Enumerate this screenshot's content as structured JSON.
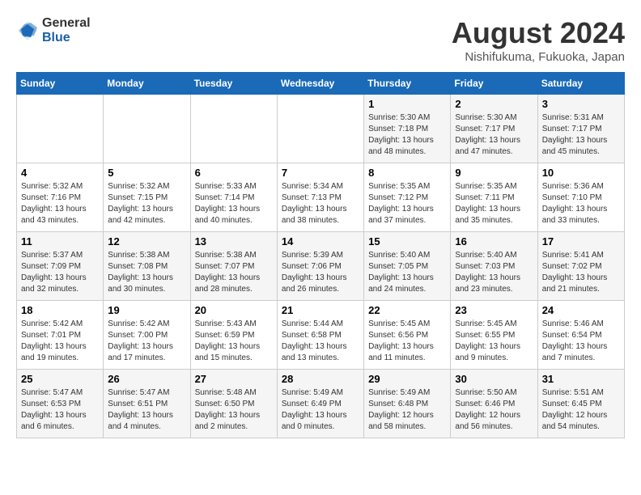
{
  "logo": {
    "general": "General",
    "blue": "Blue"
  },
  "title": "August 2024",
  "subtitle": "Nishifukuma, Fukuoka, Japan",
  "weekdays": [
    "Sunday",
    "Monday",
    "Tuesday",
    "Wednesday",
    "Thursday",
    "Friday",
    "Saturday"
  ],
  "weeks": [
    [
      {
        "day": "",
        "info": ""
      },
      {
        "day": "",
        "info": ""
      },
      {
        "day": "",
        "info": ""
      },
      {
        "day": "",
        "info": ""
      },
      {
        "day": "1",
        "sunrise": "5:30 AM",
        "sunset": "7:18 PM",
        "daylight": "13 hours and 48 minutes."
      },
      {
        "day": "2",
        "sunrise": "5:30 AM",
        "sunset": "7:17 PM",
        "daylight": "13 hours and 47 minutes."
      },
      {
        "day": "3",
        "sunrise": "5:31 AM",
        "sunset": "7:17 PM",
        "daylight": "13 hours and 45 minutes."
      }
    ],
    [
      {
        "day": "4",
        "sunrise": "5:32 AM",
        "sunset": "7:16 PM",
        "daylight": "13 hours and 43 minutes."
      },
      {
        "day": "5",
        "sunrise": "5:32 AM",
        "sunset": "7:15 PM",
        "daylight": "13 hours and 42 minutes."
      },
      {
        "day": "6",
        "sunrise": "5:33 AM",
        "sunset": "7:14 PM",
        "daylight": "13 hours and 40 minutes."
      },
      {
        "day": "7",
        "sunrise": "5:34 AM",
        "sunset": "7:13 PM",
        "daylight": "13 hours and 38 minutes."
      },
      {
        "day": "8",
        "sunrise": "5:35 AM",
        "sunset": "7:12 PM",
        "daylight": "13 hours and 37 minutes."
      },
      {
        "day": "9",
        "sunrise": "5:35 AM",
        "sunset": "7:11 PM",
        "daylight": "13 hours and 35 minutes."
      },
      {
        "day": "10",
        "sunrise": "5:36 AM",
        "sunset": "7:10 PM",
        "daylight": "13 hours and 33 minutes."
      }
    ],
    [
      {
        "day": "11",
        "sunrise": "5:37 AM",
        "sunset": "7:09 PM",
        "daylight": "13 hours and 32 minutes."
      },
      {
        "day": "12",
        "sunrise": "5:38 AM",
        "sunset": "7:08 PM",
        "daylight": "13 hours and 30 minutes."
      },
      {
        "day": "13",
        "sunrise": "5:38 AM",
        "sunset": "7:07 PM",
        "daylight": "13 hours and 28 minutes."
      },
      {
        "day": "14",
        "sunrise": "5:39 AM",
        "sunset": "7:06 PM",
        "daylight": "13 hours and 26 minutes."
      },
      {
        "day": "15",
        "sunrise": "5:40 AM",
        "sunset": "7:05 PM",
        "daylight": "13 hours and 24 minutes."
      },
      {
        "day": "16",
        "sunrise": "5:40 AM",
        "sunset": "7:03 PM",
        "daylight": "13 hours and 23 minutes."
      },
      {
        "day": "17",
        "sunrise": "5:41 AM",
        "sunset": "7:02 PM",
        "daylight": "13 hours and 21 minutes."
      }
    ],
    [
      {
        "day": "18",
        "sunrise": "5:42 AM",
        "sunset": "7:01 PM",
        "daylight": "13 hours and 19 minutes."
      },
      {
        "day": "19",
        "sunrise": "5:42 AM",
        "sunset": "7:00 PM",
        "daylight": "13 hours and 17 minutes."
      },
      {
        "day": "20",
        "sunrise": "5:43 AM",
        "sunset": "6:59 PM",
        "daylight": "13 hours and 15 minutes."
      },
      {
        "day": "21",
        "sunrise": "5:44 AM",
        "sunset": "6:58 PM",
        "daylight": "13 hours and 13 minutes."
      },
      {
        "day": "22",
        "sunrise": "5:45 AM",
        "sunset": "6:56 PM",
        "daylight": "13 hours and 11 minutes."
      },
      {
        "day": "23",
        "sunrise": "5:45 AM",
        "sunset": "6:55 PM",
        "daylight": "13 hours and 9 minutes."
      },
      {
        "day": "24",
        "sunrise": "5:46 AM",
        "sunset": "6:54 PM",
        "daylight": "13 hours and 7 minutes."
      }
    ],
    [
      {
        "day": "25",
        "sunrise": "5:47 AM",
        "sunset": "6:53 PM",
        "daylight": "13 hours and 6 minutes."
      },
      {
        "day": "26",
        "sunrise": "5:47 AM",
        "sunset": "6:51 PM",
        "daylight": "13 hours and 4 minutes."
      },
      {
        "day": "27",
        "sunrise": "5:48 AM",
        "sunset": "6:50 PM",
        "daylight": "13 hours and 2 minutes."
      },
      {
        "day": "28",
        "sunrise": "5:49 AM",
        "sunset": "6:49 PM",
        "daylight": "13 hours and 0 minutes."
      },
      {
        "day": "29",
        "sunrise": "5:49 AM",
        "sunset": "6:48 PM",
        "daylight": "12 hours and 58 minutes."
      },
      {
        "day": "30",
        "sunrise": "5:50 AM",
        "sunset": "6:46 PM",
        "daylight": "12 hours and 56 minutes."
      },
      {
        "day": "31",
        "sunrise": "5:51 AM",
        "sunset": "6:45 PM",
        "daylight": "12 hours and 54 minutes."
      }
    ]
  ],
  "labels": {
    "sunrise_prefix": "Sunrise:",
    "sunset_prefix": "Sunset:",
    "daylight_prefix": "Daylight:"
  }
}
